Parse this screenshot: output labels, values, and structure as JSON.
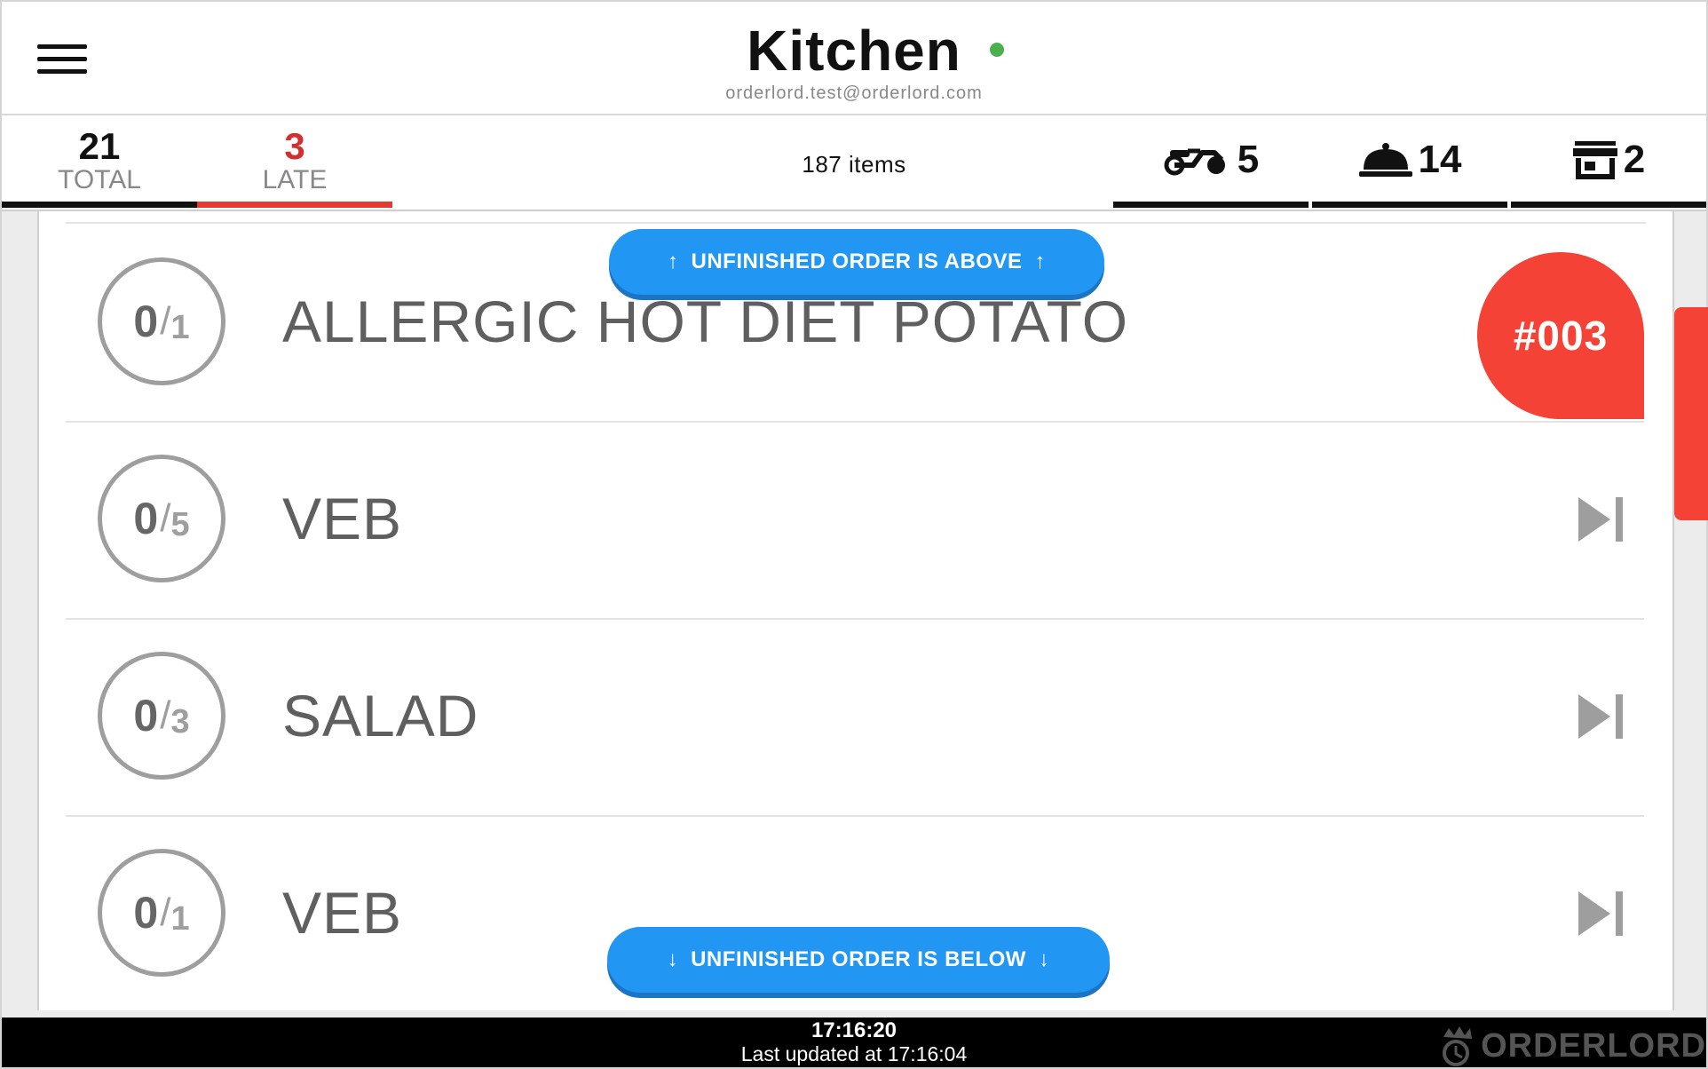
{
  "header": {
    "title": "Kitchen",
    "email": "orderlord.test@orderlord.com",
    "status_color": "#4caf50"
  },
  "stats": {
    "total": {
      "value": "21",
      "label": "TOTAL"
    },
    "late": {
      "value": "3",
      "label": "LATE"
    },
    "items": "187 items",
    "delivery": {
      "icon": "scooter-icon",
      "value": "5"
    },
    "dine_in": {
      "icon": "cloche-icon",
      "value": "14"
    },
    "takeaway": {
      "icon": "storefront-icon",
      "value": "2"
    }
  },
  "notices": {
    "above": "UNFINISHED ORDER IS ABOVE",
    "below": "UNFINISHED ORDER IS BELOW"
  },
  "items": [
    {
      "done": "0",
      "total": "1",
      "name": "ALLERGIC HOT DIET POTATO",
      "order_badge": "#003"
    },
    {
      "done": "0",
      "total": "5",
      "name": "VEB"
    },
    {
      "done": "0",
      "total": "3",
      "name": "SALAD"
    },
    {
      "done": "0",
      "total": "1",
      "name": "VEB"
    }
  ],
  "footer": {
    "clock": "17:16:20",
    "updated": "Last updated at 17:16:04",
    "brand": "ORDERLORD"
  },
  "colors": {
    "accent_blue": "#2196f3",
    "alert_red": "#f44336",
    "late_red": "#d32f2f"
  }
}
